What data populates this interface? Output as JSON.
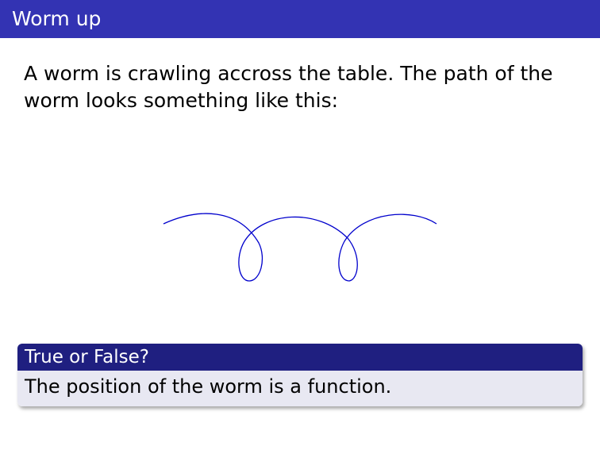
{
  "slide": {
    "title": "Worm up",
    "body_text": "A worm is crawling accross the table. The path of the worm looks something like this:",
    "block": {
      "title": "True or False?",
      "text": "The position of the worm is a function."
    }
  },
  "colors": {
    "title_bar": "#3333b3",
    "block_header": "#1f1f80",
    "block_body": "#e8e8f2",
    "curve": "#0000cc"
  }
}
